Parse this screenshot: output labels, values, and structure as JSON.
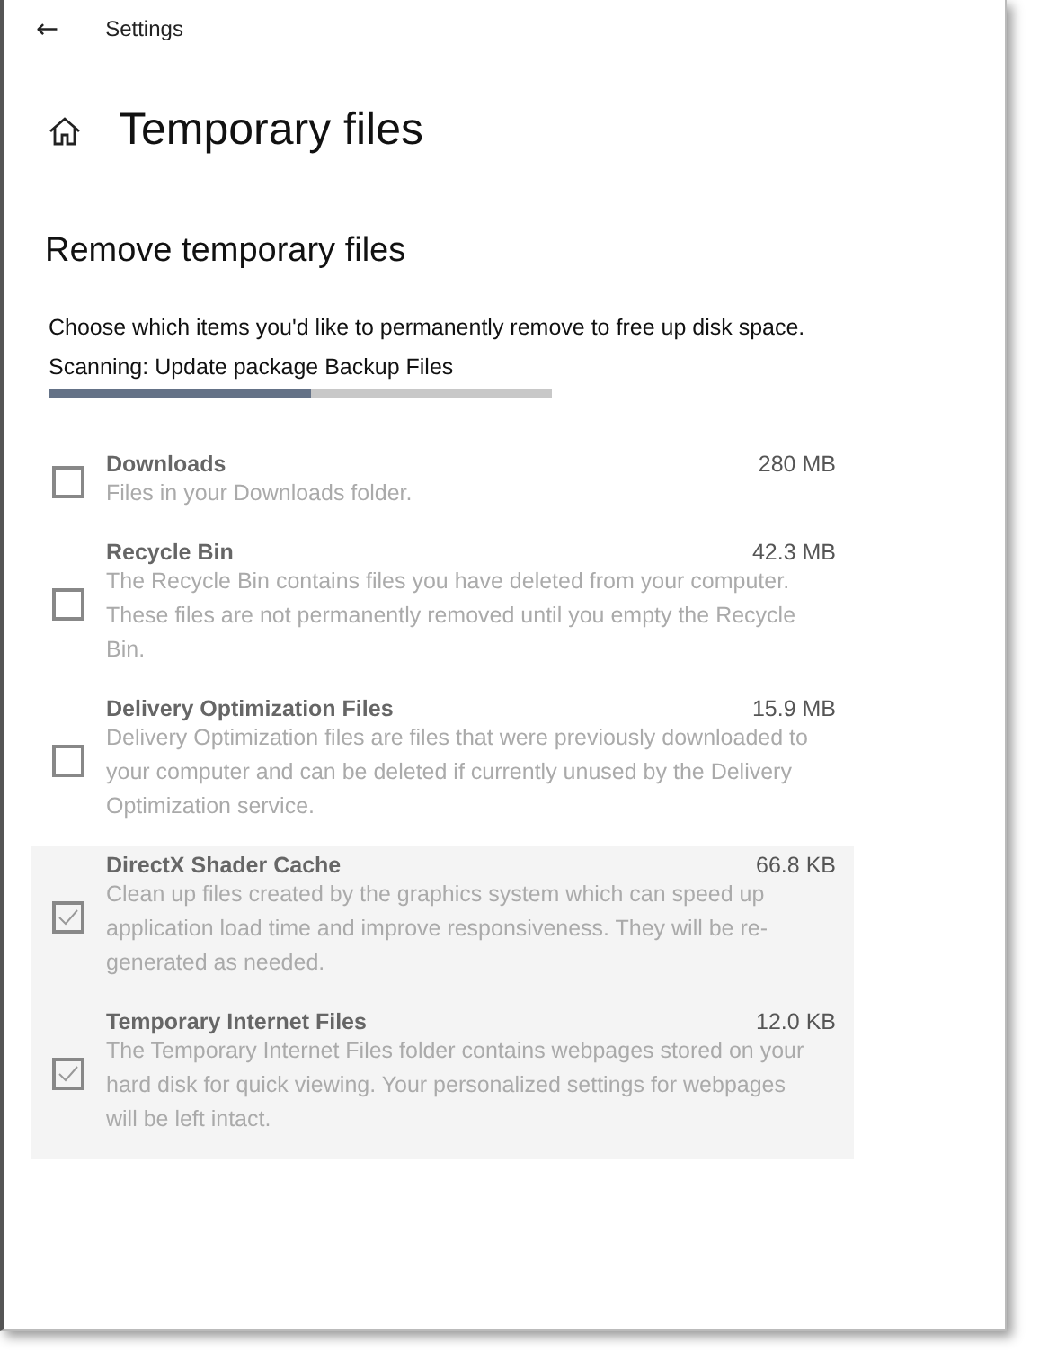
{
  "window": {
    "title": "Settings",
    "back": "←"
  },
  "page": {
    "title": "Temporary files"
  },
  "section": {
    "title": "Remove temporary files",
    "intro": "Choose which items you'd like to permanently remove to free up disk space.",
    "status": "Scanning: Update package Backup Files",
    "level": 0.52
  },
  "items": [
    {
      "name": "Downloads",
      "size": "280 MB",
      "description": "Files in your Downloads folder.",
      "checked": false,
      "disabled": true
    },
    {
      "name": "Recycle Bin",
      "size": "42.3 MB",
      "description": "The Recycle Bin contains files you have deleted from your computer. These files are not permanently removed until you empty the Recycle Bin.",
      "checked": false,
      "disabled": true
    },
    {
      "name": "Delivery Optimization Files",
      "size": "15.9 MB",
      "description": "Delivery Optimization files are files that were previously downloaded to your computer and can be deleted if currently unused by the Delivery Optimization service.",
      "checked": false,
      "disabled": true
    },
    {
      "name": "DirectX Shader Cache",
      "size": "66.8 KB",
      "description": "Clean up files created by the graphics system which can speed up application load time and improve responsiveness. They will be re-generated as needed.",
      "checked": true,
      "disabled": true
    },
    {
      "name": "Temporary Internet Files",
      "size": "12.0 KB",
      "description": "The Temporary Internet Files folder contains webpages stored on your hard disk for quick viewing. Your personalized settings for webpages will be left intact.",
      "checked": true,
      "disabled": true
    }
  ]
}
